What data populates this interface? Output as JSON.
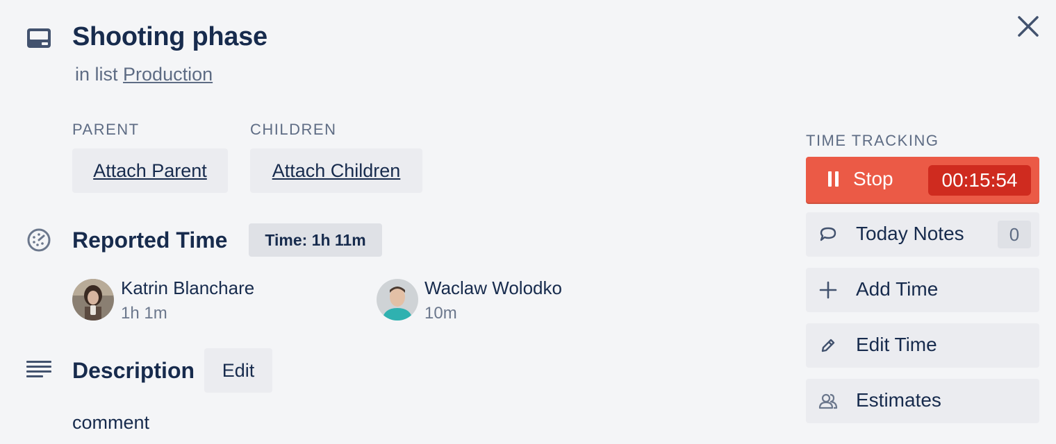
{
  "card": {
    "title": "Shooting phase",
    "in_list_prefix": "in list",
    "list_name": "Production"
  },
  "relations": {
    "parent_label": "PARENT",
    "children_label": "CHILDREN",
    "attach_parent": "Attach Parent",
    "attach_children": "Attach Children"
  },
  "reported_time": {
    "title": "Reported Time",
    "total": "Time: 1h 11m",
    "members": [
      {
        "name": "Katrin Blanchare",
        "time": "1h 1m"
      },
      {
        "name": "Waclaw Wolodko",
        "time": "10m"
      }
    ]
  },
  "description": {
    "title": "Description",
    "edit_label": "Edit",
    "text": "comment"
  },
  "time_tracking": {
    "label": "TIME TRACKING",
    "stop_label": "Stop",
    "timer": "00:15:54",
    "today_notes": "Today Notes",
    "notes_count": "0",
    "add_time": "Add Time",
    "edit_time": "Edit Time",
    "estimates": "Estimates"
  },
  "colors": {
    "stop_bg": "#eb5a46",
    "timer_bg": "#cf2b1f",
    "text": "#172b4d",
    "muted": "#5e6c84",
    "button_bg": "#ebecf0"
  },
  "icons": {
    "card": "card-icon",
    "close": "close-icon",
    "reported_time": "stopwatch-icon",
    "description": "description-lines-icon",
    "stop": "pause-icon",
    "notes": "speech-bubble-icon",
    "add": "plus-icon",
    "edit": "pencil-icon",
    "estimates": "users-icon"
  }
}
